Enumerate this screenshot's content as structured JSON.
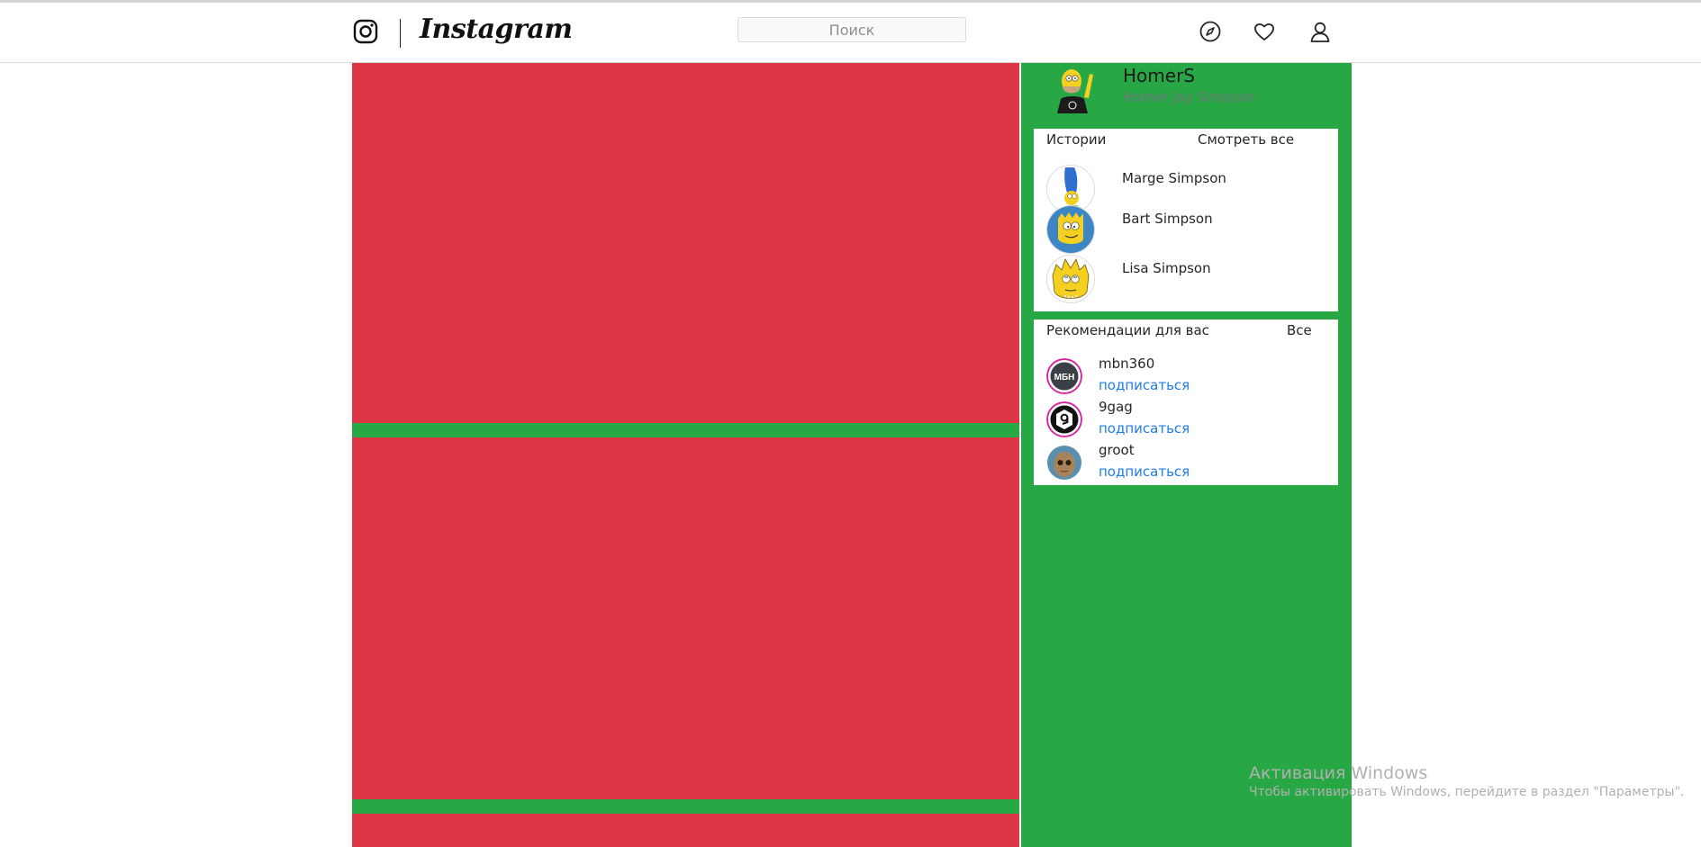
{
  "header": {
    "brand": "Instagram",
    "search": {
      "placeholder": "Поиск",
      "value": ""
    },
    "icons": [
      "instagram-logo-icon",
      "compass-icon",
      "heart-icon",
      "user-icon"
    ]
  },
  "profile": {
    "username": "HomerS",
    "fullname": "Homer Jay Simpson"
  },
  "stories": {
    "title": "Истории",
    "see_all": "Смотреть все",
    "items": [
      {
        "name": "Marge Simpson"
      },
      {
        "name": "Bart Simpson"
      },
      {
        "name": "Lisa Simpson"
      }
    ]
  },
  "recommendations": {
    "title": "Рекомендации для вас",
    "all": "Все",
    "items": [
      {
        "name": "mbn360",
        "action": "подписаться",
        "avatar_text": "МБН"
      },
      {
        "name": "9gag",
        "action": "подписаться"
      },
      {
        "name": "groot",
        "action": "подписаться"
      }
    ]
  },
  "windows_watermark": {
    "title": "Активация Windows",
    "subtitle": "Чтобы активировать Windows, перейдите в раздел \"Параметры\"."
  },
  "colors": {
    "post_background": "#dc3545",
    "feed_background": "#28a745",
    "sidebar_background": "#28a745",
    "link": "#1f7de6",
    "panel": "#ffffff"
  }
}
